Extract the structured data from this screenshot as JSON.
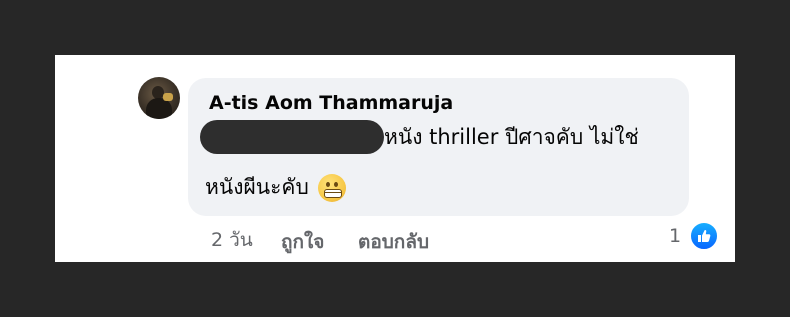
{
  "comment": {
    "author": "A-tis Aom Thammaruja",
    "text_line1": "หนัง thriller ปีศาจคับ ไม่ใช่",
    "text_line2": "หนังผีนะคับ",
    "emoji_icon": "grimacing-face-icon"
  },
  "actions": {
    "time": "2 วัน",
    "like_label": "ถูกใจ",
    "reply_label": "ตอบกลับ",
    "reaction_count": "1",
    "reaction_icon": "thumbs-up-icon"
  },
  "colors": {
    "page_background": "#272727",
    "card_background": "#ffffff",
    "bubble_background": "#f0f2f5",
    "meta_text": "#65676b",
    "like_blue": "#0866ff"
  }
}
